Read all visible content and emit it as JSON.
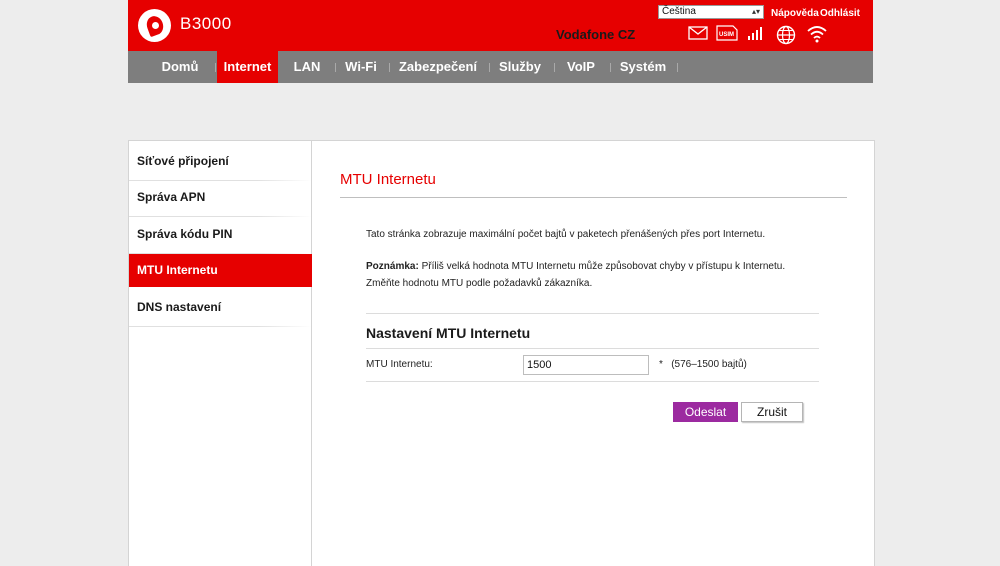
{
  "header": {
    "brand": "B3000",
    "operator": "Vodafone CZ",
    "language": {
      "selected": "Čeština"
    },
    "links": {
      "help": "Nápověda",
      "logout": "Odhlásit"
    },
    "icons": [
      "envelope-icon",
      "usim-icon",
      "signal-icon",
      "globe-icon",
      "wifi-icon"
    ],
    "usim_text": "USIM",
    "colors": {
      "brand_red": "#e60000",
      "nav_gray": "#7e7e7e",
      "button_purple": "#9c2aa0"
    }
  },
  "nav": {
    "items": [
      "Domů",
      "Internet",
      "LAN",
      "Wi-Fi",
      "Zabezpečení",
      "Služby",
      "VoIP",
      "Systém"
    ],
    "active": "Internet"
  },
  "sidebar": {
    "items": [
      "Síťové připojení",
      "Správa APN",
      "Správa kódu PIN",
      "MTU Internetu",
      "DNS nastavení"
    ],
    "active": "MTU Internetu"
  },
  "main": {
    "title": "MTU Internetu",
    "description": "Tato stránka zobrazuje maximální počet bajtů v paketech přenášených přes port Internetu.",
    "note_label": "Poznámka:",
    "note_text": " Příliš velká hodnota MTU Internetu může způsobovat chyby v přístupu k Internetu. Změňte hodnotu MTU podle požadavků zákazníka.",
    "section_title": "Nastavení MTU Internetu",
    "field": {
      "label": "MTU Internetu:",
      "value": "1500",
      "hint": "*   (576–1500 bajtů)"
    },
    "buttons": {
      "submit": "Odeslat",
      "cancel": "Zrušit"
    }
  }
}
